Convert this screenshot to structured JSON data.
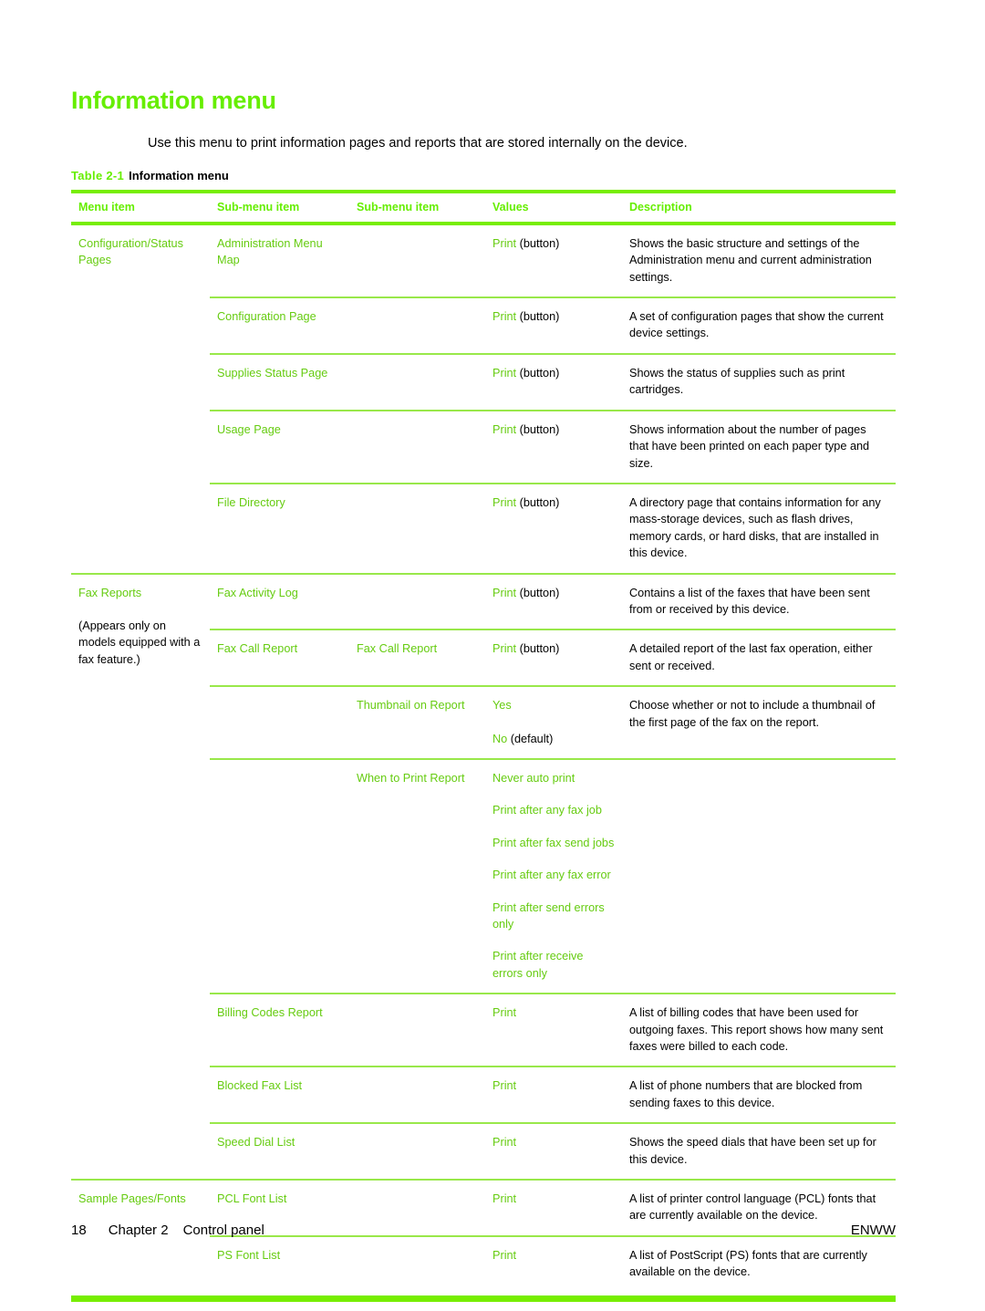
{
  "page": {
    "title": "Information menu",
    "intro": "Use this menu to print information pages and reports that are stored internally on the device.",
    "table_caption_number": "Table 2-1",
    "table_caption_text": "Information menu",
    "accent_green": "#66ee00",
    "rule_green": "#77ee00",
    "text_green": "#66cc11"
  },
  "table": {
    "headers": [
      "Menu item",
      "Sub-menu item",
      "Sub-menu item",
      "Values",
      "Description"
    ],
    "groups": [
      {
        "menu_item": "Configuration/Status Pages",
        "menu_item_note": "",
        "rows": [
          {
            "sub1": "Administration Menu Map",
            "sub2": "",
            "value": "Print",
            "value_note": "(button)",
            "description": "Shows the basic structure and settings of the Administration menu and current administration settings."
          },
          {
            "sub1": "Configuration Page",
            "sub2": "",
            "value": "Print",
            "value_note": "(button)",
            "description": "A set of configuration pages that show the current device settings."
          },
          {
            "sub1": "Supplies Status Page",
            "sub2": "",
            "value": "Print",
            "value_note": "(button)",
            "description": "Shows the status of supplies such as print cartridges."
          },
          {
            "sub1": "Usage Page",
            "sub2": "",
            "value": "Print",
            "value_note": "(button)",
            "description": "Shows information about the number of pages that have been printed on each paper type and size."
          },
          {
            "sub1": "File Directory",
            "sub2": "",
            "value": "Print",
            "value_note": "(button)",
            "description": "A directory page that contains information for any mass-storage devices, such as flash drives, memory cards, or hard disks, that are installed in this device."
          }
        ]
      },
      {
        "menu_item": "Fax Reports",
        "menu_item_note": "(Appears only on models equipped with a fax feature.)",
        "rows": [
          {
            "sub1": "Fax Activity Log",
            "sub2": "",
            "value": "Print",
            "value_note": "(button)",
            "description": "Contains a list of the faxes that have been sent from or received by this device."
          },
          {
            "sub1": "Fax Call Report",
            "sub2": "Fax Call Report",
            "value": "Print",
            "value_note": "(button)",
            "description": "A detailed report of the last fax operation, either sent or received."
          },
          {
            "sub1": "",
            "sub2": "Thumbnail on Report",
            "value": "Yes",
            "value2": "No",
            "value2_note": "(default)",
            "description": "Choose whether or not to include a thumbnail of the first page of the fax on the report."
          },
          {
            "sub1": "",
            "sub2": "When to Print Report",
            "values": [
              "Never auto print",
              "Print after any fax job",
              "Print after fax send jobs",
              "Print after any fax error",
              "Print after send errors only",
              "Print after receive errors only"
            ],
            "description": ""
          },
          {
            "sub1": "Billing Codes Report",
            "sub2": "",
            "value": "Print",
            "value_note": "",
            "description": "A list of billing codes that have been used for outgoing faxes. This report shows how many sent faxes were billed to each code."
          },
          {
            "sub1": "Blocked Fax List",
            "sub2": "",
            "value": "Print",
            "value_note": "",
            "description": "A list of phone numbers that are blocked from sending faxes to this device."
          },
          {
            "sub1": "Speed Dial List",
            "sub2": "",
            "value": "Print",
            "value_note": "",
            "description": "Shows the speed dials that have been set up for this device."
          }
        ]
      },
      {
        "menu_item": "Sample Pages/Fonts",
        "menu_item_note": "",
        "rows": [
          {
            "sub1": "PCL Font List",
            "sub2": "",
            "value": "Print",
            "value_note": "",
            "description": "A list of printer control language (PCL) fonts that are currently available on the device."
          },
          {
            "sub1": "PS Font List",
            "sub2": "",
            "value": "Print",
            "value_note": "",
            "description": "A list of PostScript (PS) fonts that are currently available on the device."
          }
        ]
      }
    ]
  },
  "footer": {
    "page_number": "18",
    "chapter": "Chapter 2",
    "chapter_title": "Control panel",
    "right": "ENWW"
  }
}
